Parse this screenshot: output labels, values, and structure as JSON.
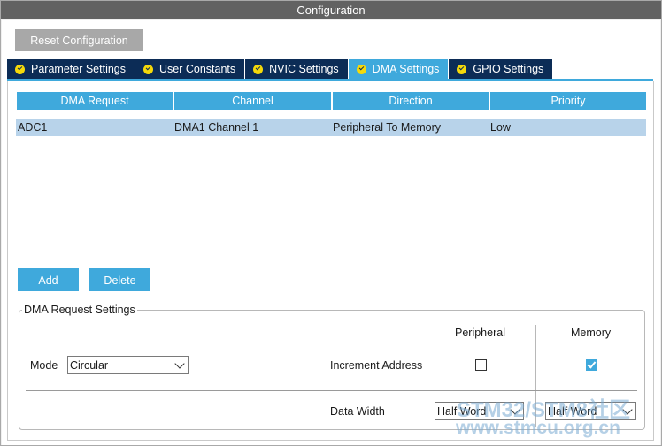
{
  "window": {
    "title": "Configuration"
  },
  "toolbar": {
    "reset_label": "Reset Configuration"
  },
  "tabs": [
    {
      "label": "Parameter Settings",
      "icon": "check-circle-icon",
      "active": false
    },
    {
      "label": "User Constants",
      "icon": "check-circle-icon",
      "active": false
    },
    {
      "label": "NVIC Settings",
      "icon": "check-circle-icon",
      "active": false
    },
    {
      "label": "DMA Settings",
      "icon": "check-circle-icon",
      "active": true
    },
    {
      "label": "GPIO Settings",
      "icon": "check-circle-icon",
      "active": false
    }
  ],
  "table": {
    "headers": [
      "DMA Request",
      "Channel",
      "Direction",
      "Priority"
    ],
    "rows": [
      [
        "ADC1",
        "DMA1 Channel 1",
        "Peripheral To Memory",
        "Low"
      ]
    ]
  },
  "actions": {
    "add_label": "Add",
    "delete_label": "Delete"
  },
  "dma_settings": {
    "group_title": "DMA Request Settings",
    "mode_label": "Mode",
    "mode_value": "Circular",
    "peripheral_header": "Peripheral",
    "memory_header": "Memory",
    "increment_label": "Increment Address",
    "peripheral_increment": false,
    "memory_increment": true,
    "data_width_label": "Data Width",
    "peripheral_width": "Half Word",
    "memory_width": "Half Word"
  },
  "watermark": {
    "line1": "STM32/STM8社区",
    "line2": "www.stmcu.org.cn"
  },
  "colors": {
    "accent": "#3fa9dc",
    "tab_dark": "#0c2c56",
    "title_bar": "#626262",
    "check_badge": "#f5d90a",
    "row_selected": "#b8d3ea"
  }
}
